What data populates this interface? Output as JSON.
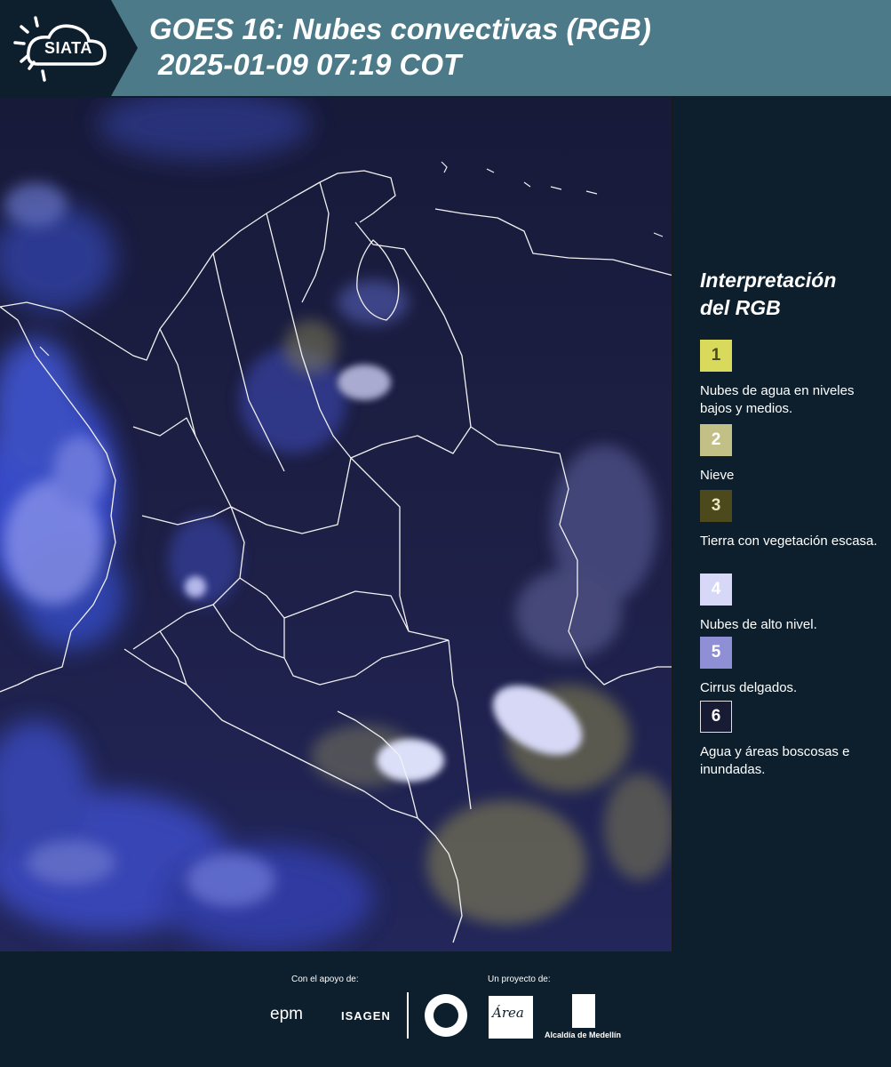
{
  "header": {
    "logo_text": "SIATA",
    "title_line1": "GOES 16: Nubes convectivas (RGB)",
    "title_line2": "2025-01-09 07:19 COT"
  },
  "map": {
    "description_icon": "satellite-rgb-map"
  },
  "legend": {
    "title_line1": "Interpretación",
    "title_line2": "del RGB",
    "items": [
      {
        "number": "1",
        "label": "Nubes de agua en niveles bajos y medios.",
        "color": "#d9d95c",
        "text_color": "#4a4a20"
      },
      {
        "number": "2",
        "label": "Nieve",
        "color": "#c2c087",
        "text_color": "#ffffff"
      },
      {
        "number": "3",
        "label": "Tierra con vegetación escasa.",
        "color": "#4c4a1c",
        "text_color": "#e8e8c0"
      },
      {
        "number": "4",
        "label": "Nubes de alto nivel.",
        "color": "#d7d8f7",
        "text_color": "#ffffff"
      },
      {
        "number": "5",
        "label": "Cirrus delgados.",
        "color": "#8f8fd6",
        "text_color": "#ffffff"
      },
      {
        "number": "6",
        "label": "Agua y áreas boscosas e inundadas.",
        "color": "#171b33",
        "text_color": "#ffffff"
      }
    ]
  },
  "footer": {
    "support_label": "Con el apoyo de:",
    "project_label": "Un proyecto de:",
    "epm": "epm",
    "isagen": "ISAGEN",
    "area_text": "Área",
    "alcaldia": "Alcaldía de Medellín"
  }
}
